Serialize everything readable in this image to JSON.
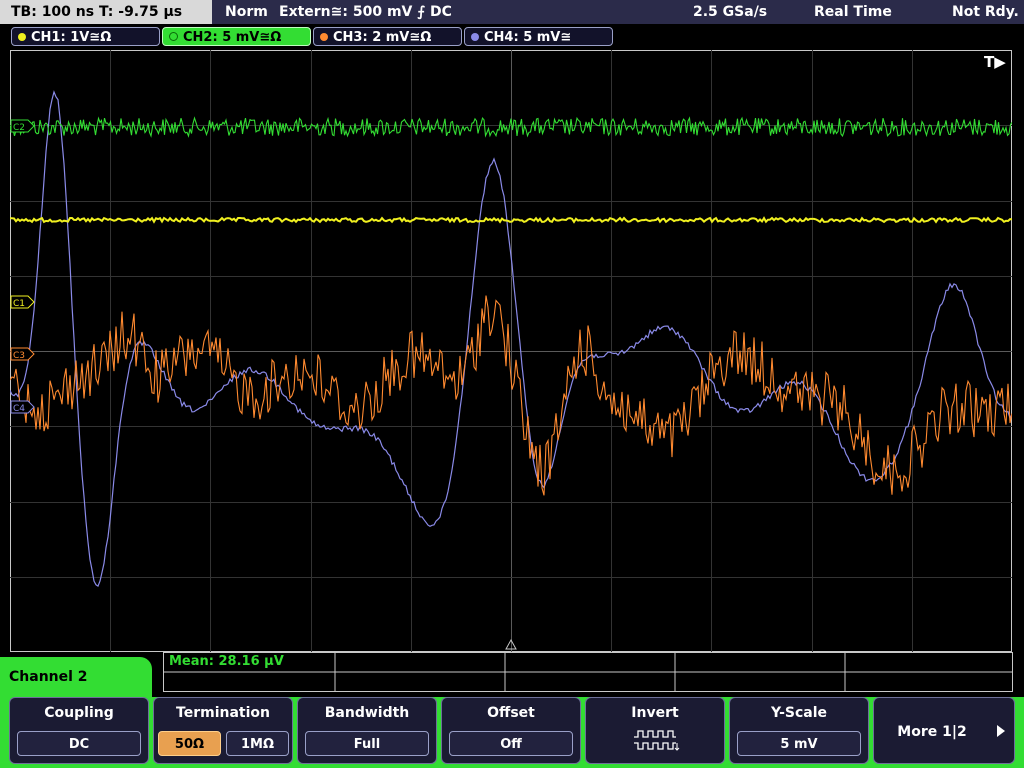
{
  "status_bar": {
    "timebase": "TB: 100 ns",
    "trigger_time": "T: -9.75 µs",
    "mode": "Norm",
    "trigger_source": "Extern≅: 500 mV ⨍ DC",
    "sample_rate": "2.5 GSa/s",
    "acquisition": "Real Time",
    "state": "Not Rdy."
  },
  "channels": [
    {
      "label": "CH1: 1V≅Ω",
      "color": "#f0f020",
      "active": false
    },
    {
      "label": "CH2: 5 mV≅Ω",
      "color": "#33dd33",
      "active": true
    },
    {
      "label": "CH3: 2 mV≅Ω",
      "color": "#ff8a30",
      "active": false
    },
    {
      "label": "CH4: 5 mV≅",
      "color": "#8a8ae8",
      "active": false
    }
  ],
  "plot": {
    "trigger_marker": "T▶",
    "markers": {
      "c1": "C1",
      "c2": "C2",
      "c3": "C3",
      "c4": "C4"
    }
  },
  "measurement": {
    "label": "Mean: 28.16 µV"
  },
  "menu": {
    "title": "Channel 2",
    "softkeys": {
      "coupling": {
        "label": "Coupling",
        "value": "DC"
      },
      "termination": {
        "label": "Termination",
        "option_a": "50Ω",
        "option_b": "1MΩ",
        "selected": "50Ω"
      },
      "bandwidth": {
        "label": "Bandwidth",
        "value": "Full"
      },
      "offset": {
        "label": "Offset",
        "value": "Off"
      },
      "invert": {
        "label": "Invert"
      },
      "y_scale": {
        "label": "Y-Scale",
        "value": "5 mV"
      },
      "more": {
        "label": "More 1|2"
      }
    }
  },
  "colors": {
    "ch1": "#f0f020",
    "ch2": "#33dd33",
    "ch3": "#ff8a30",
    "ch4": "#8a8ae8",
    "grid": "#3a3a3a",
    "border": "#c8c8c8"
  }
}
